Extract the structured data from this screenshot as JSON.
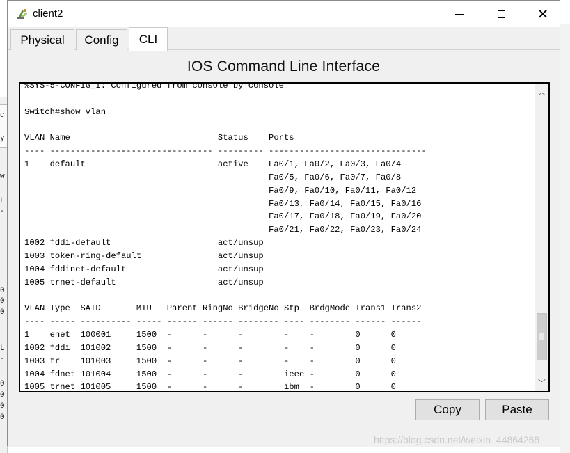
{
  "window": {
    "title": "client2",
    "icon": "packet-tracer-device-icon",
    "controls": {
      "minimize": "minimize-icon",
      "maximize": "maximize-icon",
      "close": "close-icon"
    }
  },
  "tabs": [
    {
      "label": "Physical",
      "active": false
    },
    {
      "label": "Config",
      "active": false
    },
    {
      "label": "CLI",
      "active": true
    }
  ],
  "cli": {
    "title": "IOS Command Line Interface",
    "output": "%SYS-5-CONFIG_I: Configured from console by console\n\nSwitch#show vlan\n\nVLAN Name                             Status    Ports\n---- -------------------------------- --------- -------------------------------\n1    default                          active    Fa0/1, Fa0/2, Fa0/3, Fa0/4\n                                                Fa0/5, Fa0/6, Fa0/7, Fa0/8\n                                                Fa0/9, Fa0/10, Fa0/11, Fa0/12\n                                                Fa0/13, Fa0/14, Fa0/15, Fa0/16\n                                                Fa0/17, Fa0/18, Fa0/19, Fa0/20\n                                                Fa0/21, Fa0/22, Fa0/23, Fa0/24\n1002 fddi-default                     act/unsup\n1003 token-ring-default               act/unsup\n1004 fddinet-default                  act/unsup\n1005 trnet-default                    act/unsup\n\nVLAN Type  SAID       MTU   Parent RingNo BridgeNo Stp  BrdgMode Trans1 Trans2\n---- ----- ---------- ----- ------ ------ -------- ---- -------- ------ ------\n1    enet  100001     1500  -      -      -        -    -        0      0\n1002 fddi  101002     1500  -      -      -        -    -        0      0\n1003 tr    101003     1500  -      -      -        -    -        0      0\n1004 fdnet 101004     1500  -      -      -        ieee -        0      0\n1005 trnet 101005     1500  -      -      -        ibm  -        0      0",
    "buttons": {
      "copy": "Copy",
      "paste": "Paste"
    }
  },
  "background": {
    "fragments": [
      "c",
      "y",
      "w",
      "L",
      "-",
      "0",
      "0",
      "0",
      "L",
      "-",
      "0",
      "0",
      "0",
      "0"
    ]
  },
  "watermark": "https://blog.csdn.net/weixin_44864268"
}
